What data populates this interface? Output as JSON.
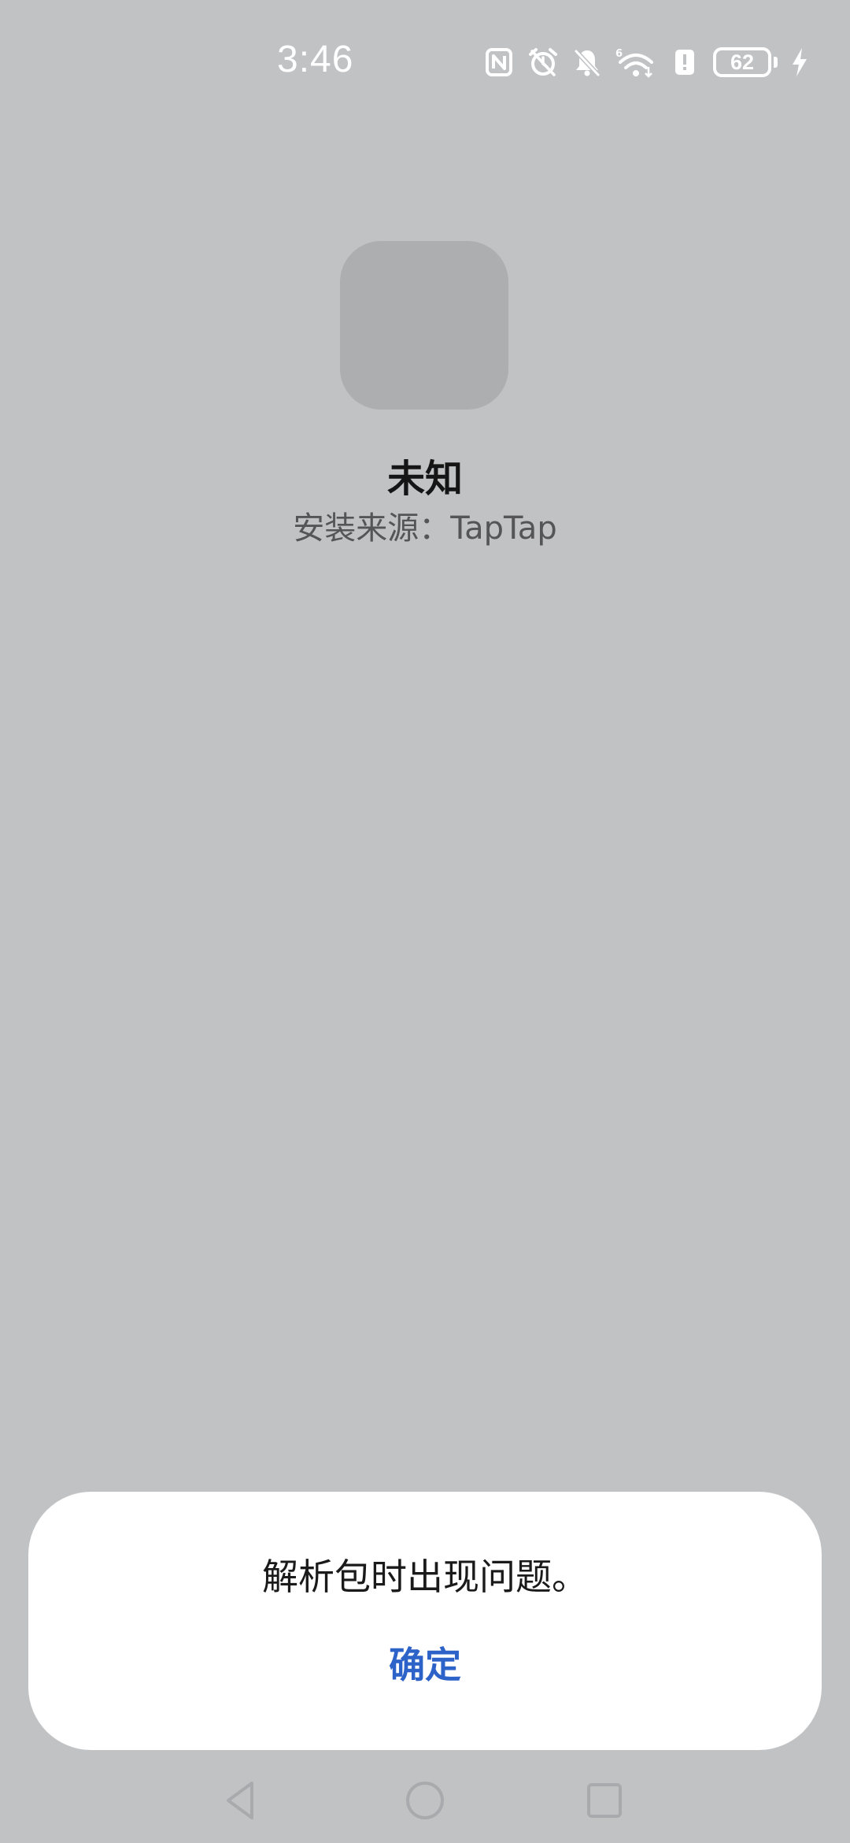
{
  "status_bar": {
    "time": "3:46",
    "battery_level": "62",
    "icons": [
      "nfc-icon",
      "alarm-icon",
      "bell-off-icon",
      "wifi-6-icon",
      "battery-alert-icon",
      "battery-icon",
      "charging-icon"
    ]
  },
  "app": {
    "name": "未知",
    "install_source": "安装来源：TapTap"
  },
  "dialog": {
    "message": "解析包时出现问题。",
    "confirm_label": "确定"
  },
  "colors": {
    "background": "#c1c2c4",
    "accent": "#2d63c8",
    "dialog_bg": "#ffffff"
  }
}
